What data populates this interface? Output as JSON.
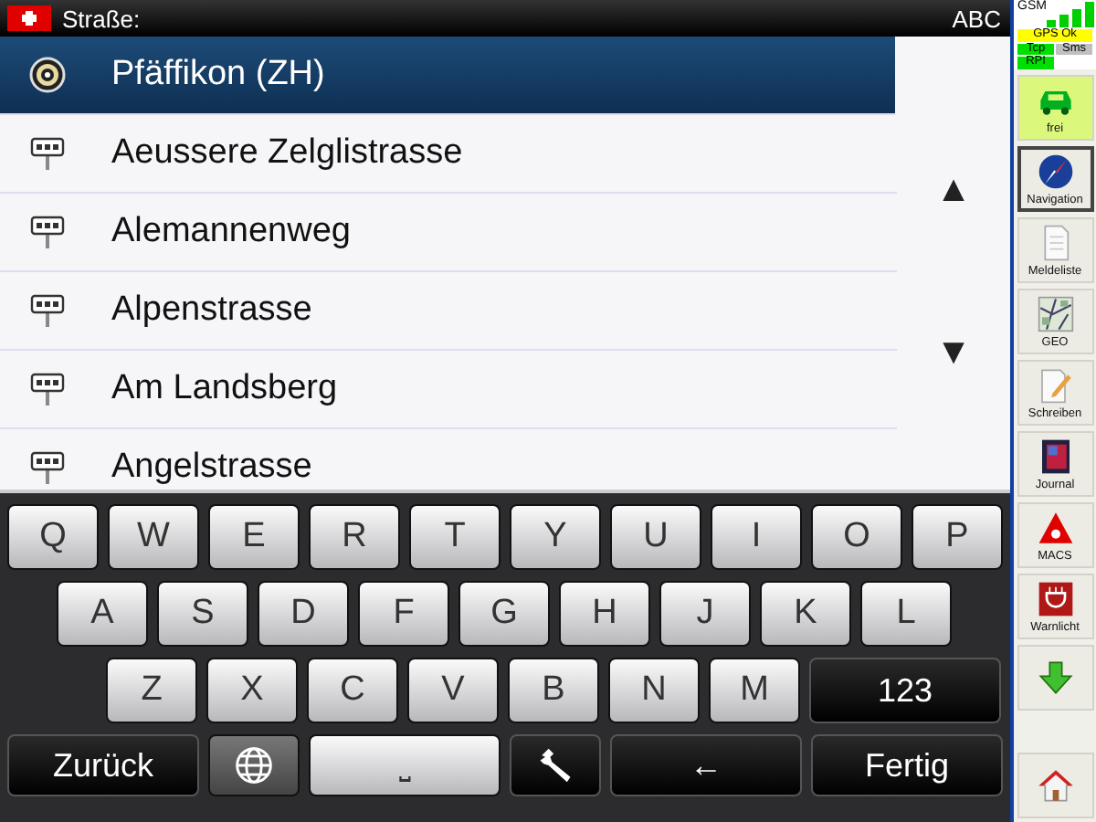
{
  "top_bar": {
    "field_label": "Straße:",
    "mode": "ABC"
  },
  "list": {
    "items": [
      {
        "kind": "place",
        "label": "Pfäffikon (ZH)",
        "selected": true
      },
      {
        "kind": "street",
        "label": "Aeussere Zelglistrasse",
        "selected": false
      },
      {
        "kind": "street",
        "label": "Alemannenweg",
        "selected": false
      },
      {
        "kind": "street",
        "label": "Alpenstrasse",
        "selected": false
      },
      {
        "kind": "street",
        "label": "Am Landsberg",
        "selected": false
      },
      {
        "kind": "street",
        "label": "Angelstrasse",
        "selected": false
      }
    ],
    "scroll_up": "▲",
    "scroll_down": "▼"
  },
  "keyboard": {
    "rows": [
      [
        {
          "kind": "letter",
          "label": "Q"
        },
        {
          "kind": "letter",
          "label": "W"
        },
        {
          "kind": "letter",
          "label": "E"
        },
        {
          "kind": "letter",
          "label": "R"
        },
        {
          "kind": "letter",
          "label": "T"
        },
        {
          "kind": "letter",
          "label": "Y"
        },
        {
          "kind": "letter",
          "label": "U"
        },
        {
          "kind": "letter",
          "label": "I"
        },
        {
          "kind": "letter",
          "label": "O"
        },
        {
          "kind": "letter",
          "label": "P"
        }
      ],
      [
        {
          "kind": "letter",
          "label": "A"
        },
        {
          "kind": "letter",
          "label": "S"
        },
        {
          "kind": "letter",
          "label": "D"
        },
        {
          "kind": "letter",
          "label": "F"
        },
        {
          "kind": "letter",
          "label": "G"
        },
        {
          "kind": "letter",
          "label": "H"
        },
        {
          "kind": "letter",
          "label": "J"
        },
        {
          "kind": "letter",
          "label": "K"
        },
        {
          "kind": "letter",
          "label": "L"
        }
      ],
      [
        {
          "kind": "letter",
          "label": "Z"
        },
        {
          "kind": "letter",
          "label": "X"
        },
        {
          "kind": "letter",
          "label": "C"
        },
        {
          "kind": "letter",
          "label": "V"
        },
        {
          "kind": "letter",
          "label": "B"
        },
        {
          "kind": "letter",
          "label": "N"
        },
        {
          "kind": "letter",
          "label": "M"
        },
        {
          "kind": "wide-dark",
          "label": "123"
        }
      ],
      [
        {
          "kind": "wide-dark",
          "label": "Zurück"
        },
        {
          "kind": "globe"
        },
        {
          "kind": "space",
          "label": "⎵"
        },
        {
          "kind": "wrench"
        },
        {
          "kind": "wide-dark",
          "label": "←"
        },
        {
          "kind": "wide-dark",
          "label": "Fertig"
        }
      ]
    ]
  },
  "status": {
    "gsm_label": "GSM",
    "indicators": [
      {
        "label": "GPS Ok",
        "color": "#ffff00"
      },
      {
        "label": "Tcp",
        "color": "#00e000"
      },
      {
        "label": "Sms",
        "color": "#c0c0c0"
      },
      {
        "label": "RPI",
        "color": "#00e000"
      }
    ]
  },
  "sidebar": {
    "items": [
      {
        "kind": "car",
        "label": "frei",
        "active": true,
        "selected": false
      },
      {
        "kind": "compass",
        "label": "Navigation",
        "active": false,
        "selected": true
      },
      {
        "kind": "document",
        "label": "Meldeliste",
        "active": false,
        "selected": false
      },
      {
        "kind": "map",
        "label": "GEO",
        "active": false,
        "selected": false
      },
      {
        "kind": "pencil",
        "label": "Schreiben",
        "active": false,
        "selected": false
      },
      {
        "kind": "journal",
        "label": "Journal",
        "active": false,
        "selected": false
      },
      {
        "kind": "triangle",
        "label": "MACS",
        "active": false,
        "selected": false
      },
      {
        "kind": "warnlight",
        "label": "Warnlicht",
        "active": false,
        "selected": false
      },
      {
        "kind": "arrow",
        "active": false,
        "selected": false
      },
      {
        "kind": "home",
        "active": false,
        "selected": false
      }
    ]
  }
}
